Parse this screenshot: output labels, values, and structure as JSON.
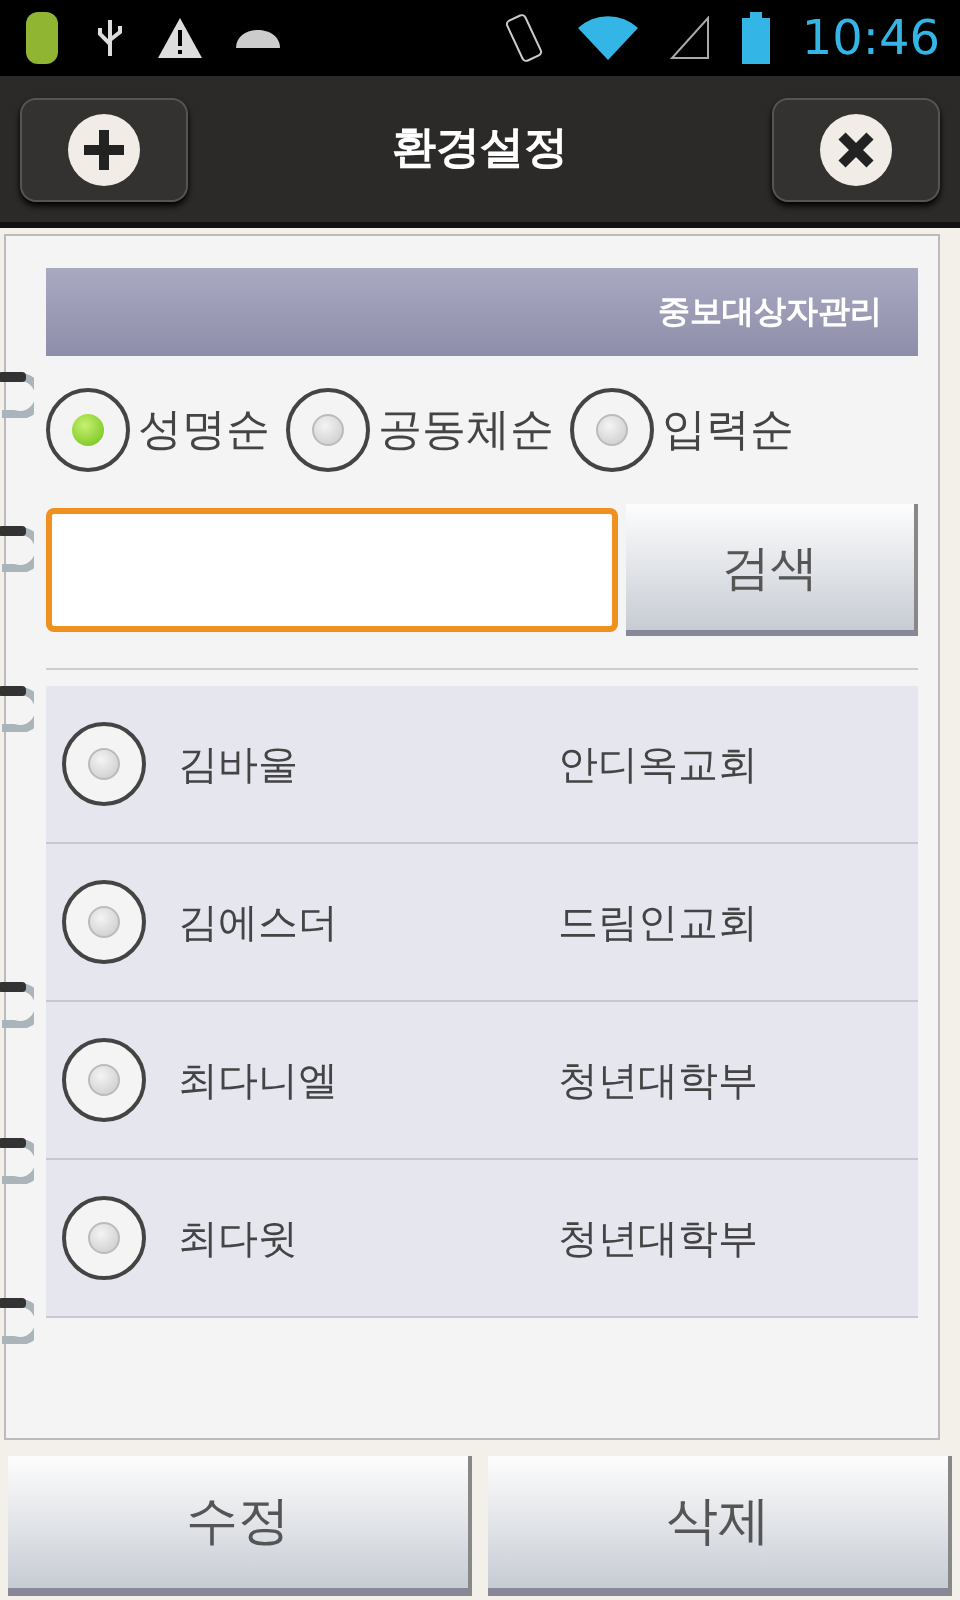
{
  "status_bar": {
    "time": "10:46"
  },
  "header": {
    "title": "환경설정"
  },
  "section": {
    "title": "중보대상자관리"
  },
  "sort_options": [
    {
      "label": "성명순",
      "selected": true
    },
    {
      "label": "공동체순",
      "selected": false
    },
    {
      "label": "입력순",
      "selected": false
    }
  ],
  "search": {
    "button": "검색"
  },
  "people": [
    {
      "name": "김바울",
      "group": "안디옥교회",
      "selected": false
    },
    {
      "name": "김에스더",
      "group": "드림인교회",
      "selected": false
    },
    {
      "name": "최다니엘",
      "group": "청년대학부",
      "selected": false
    },
    {
      "name": "최다윗",
      "group": "청년대학부",
      "selected": false
    }
  ],
  "buttons": [
    "수정",
    "삭제"
  ]
}
